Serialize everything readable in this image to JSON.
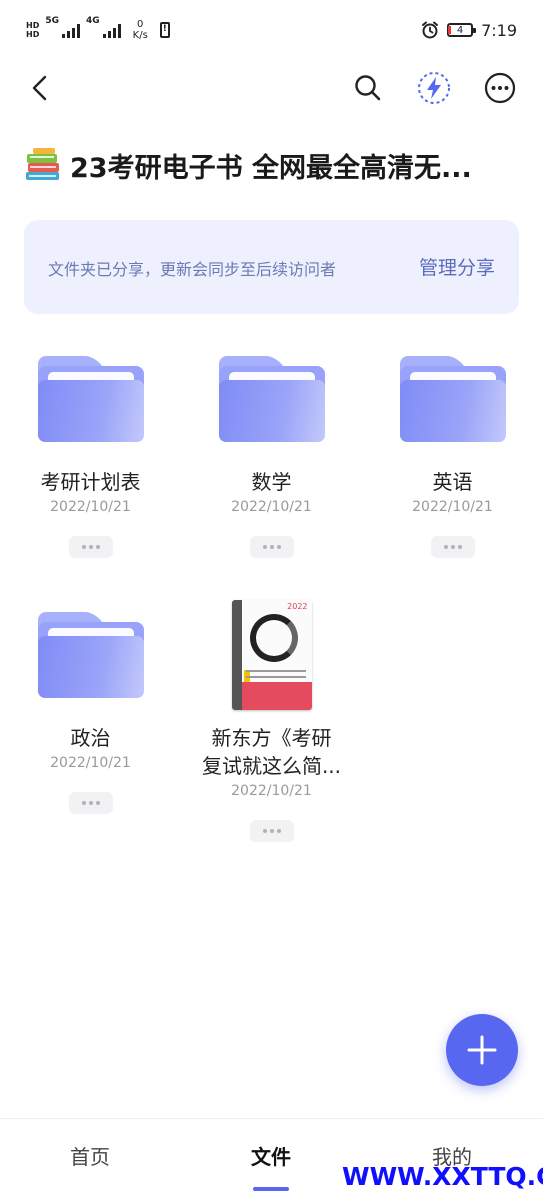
{
  "status_bar": {
    "sim_top": "HD",
    "sim_bottom": "HD",
    "net1": "5G",
    "net2": "4G",
    "speed_value": "0",
    "speed_unit": "K/s",
    "battery_level": "4",
    "time": "7:19",
    "battery_color": "#e53935"
  },
  "header": {
    "back_icon": "back-arrow-icon",
    "search_icon": "search-icon",
    "boost_icon": "lightning-icon",
    "more_icon": "more-icon"
  },
  "title": {
    "emoji": "books-icon",
    "text": "23考研电子书 全网最全高清无..."
  },
  "share_banner": {
    "message": "文件夹已分享，更新会同步至后续访问者",
    "action": "管理分享"
  },
  "items": [
    {
      "type": "folder",
      "name": "考研计划表",
      "date": "2022/10/21"
    },
    {
      "type": "folder",
      "name": "数学",
      "date": "2022/10/21"
    },
    {
      "type": "folder",
      "name": "英语",
      "date": "2022/10/21"
    },
    {
      "type": "folder",
      "name": "政治",
      "date": "2022/10/21"
    },
    {
      "type": "file",
      "name_line1": "新东方《考研",
      "name_line2": "复试就这么简...",
      "date": "2022/10/21",
      "cover_year": "2022"
    }
  ],
  "fab": {
    "icon": "plus-icon"
  },
  "bottom_nav": {
    "items": [
      {
        "label": "首页"
      },
      {
        "label": "文件",
        "active": true
      },
      {
        "label": "我的"
      }
    ]
  },
  "watermark": "WWW.XXTTQ.COM",
  "colors": {
    "accent": "#5767f0",
    "banner_bg": "#eef1fd",
    "folder": "#98a2fa"
  }
}
